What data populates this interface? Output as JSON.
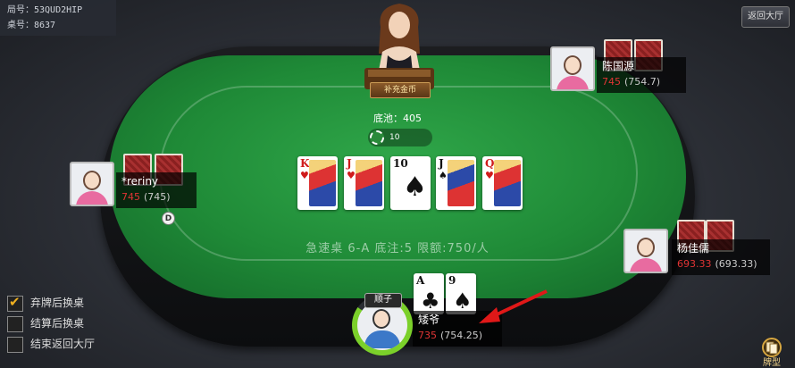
{
  "info": {
    "round_label": "局号：53QUD2HIP",
    "table_label": "桌号：8637"
  },
  "top_right_button": "返回大厅",
  "dealer": {
    "recharge_button": "补充金币"
  },
  "pot": {
    "label": "底池：405",
    "bet": "10"
  },
  "community_cards": [
    {
      "rank": "K",
      "suit": "♥",
      "color": "red",
      "face": "red"
    },
    {
      "rank": "J",
      "suit": "♥",
      "color": "red",
      "face": "red"
    },
    {
      "rank": "10",
      "suit": "♠",
      "color": "black",
      "face": ""
    },
    {
      "rank": "J",
      "suit": "♠",
      "color": "black",
      "face": "blue"
    },
    {
      "rank": "Q",
      "suit": "♥",
      "color": "red",
      "face": "red"
    }
  ],
  "table_info": "急速桌 6-A  底注:5  限额:750/人",
  "players": {
    "top_right": {
      "name": "陈国源",
      "stack": "745",
      "total": "(754.7)"
    },
    "left": {
      "name": "*reriny",
      "stack": "745",
      "total": "(745)"
    },
    "right": {
      "name": "杨佳儒",
      "stack": "693.33",
      "total": "(693.33)"
    },
    "me": {
      "name": "矮爷",
      "stack": "735",
      "total": "(754.25)",
      "hand_type": "顺子",
      "cards": [
        {
          "rank": "A",
          "suit": "♣"
        },
        {
          "rank": "9",
          "suit": "♠"
        }
      ]
    }
  },
  "dealer_button": "D",
  "options": [
    {
      "label": "弃牌后换桌",
      "checked": true
    },
    {
      "label": "结算后换桌",
      "checked": false
    },
    {
      "label": "结束返回大厅",
      "checked": false
    }
  ],
  "card_type_button": "牌型",
  "colors": {
    "felt": "#1f8a37",
    "accent_red": "#e03434",
    "arrow": "#e01818",
    "ring": "#7bd02a"
  }
}
